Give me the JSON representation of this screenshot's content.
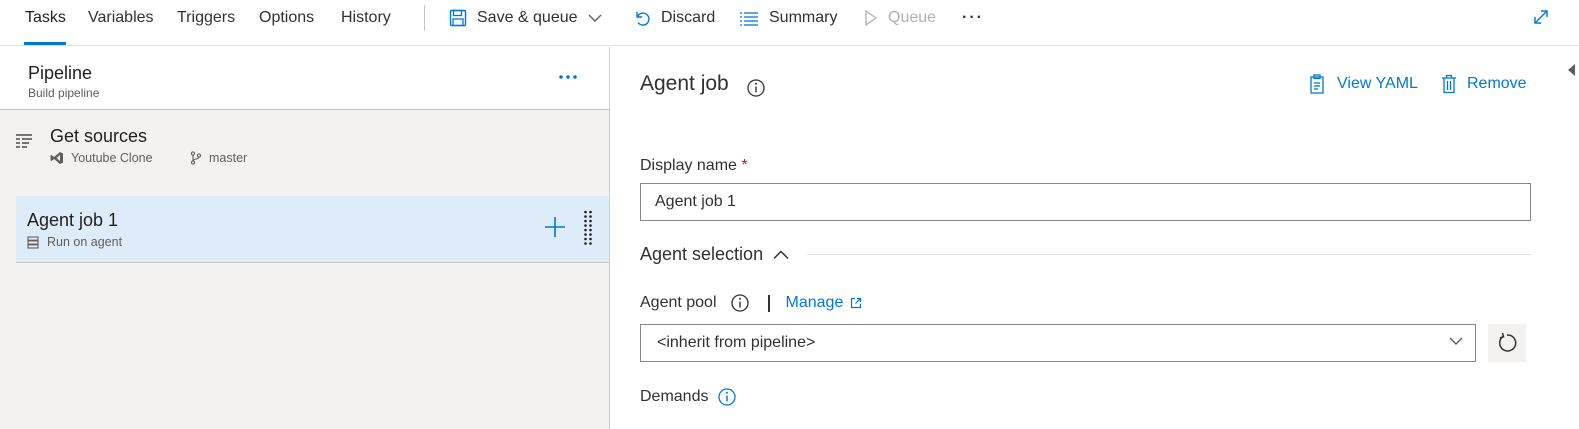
{
  "toolbar": {
    "tabs": [
      {
        "label": "Tasks",
        "active": true
      },
      {
        "label": "Variables"
      },
      {
        "label": "Triggers"
      },
      {
        "label": "Options"
      },
      {
        "label": "History"
      }
    ],
    "save_queue_label": "Save & queue",
    "discard_label": "Discard",
    "summary_label": "Summary",
    "queue_label": "Queue",
    "more_label": "···"
  },
  "left_panel": {
    "pipeline_title": "Pipeline",
    "pipeline_subtitle": "Build pipeline",
    "get_sources": {
      "title": "Get sources",
      "repo": "Youtube Clone",
      "branch": "master"
    },
    "agent_job": {
      "title": "Agent job 1",
      "subtitle": "Run on agent",
      "selected": true
    }
  },
  "right_panel": {
    "title": "Agent job",
    "view_yaml_label": "View YAML",
    "remove_label": "Remove",
    "display_name_label": "Display name",
    "required_mark": "*",
    "display_name_value": "Agent job 1",
    "agent_selection_label": "Agent selection",
    "agent_pool_label": "Agent pool",
    "manage_label": "Manage",
    "agent_pool_value": "<inherit from pipeline>",
    "demands_label": "Demands"
  },
  "colors": {
    "accent": "#0078d4",
    "selected_row": "#deecf9",
    "panel_bg": "#f3f2f1",
    "required": "#a4262c"
  }
}
